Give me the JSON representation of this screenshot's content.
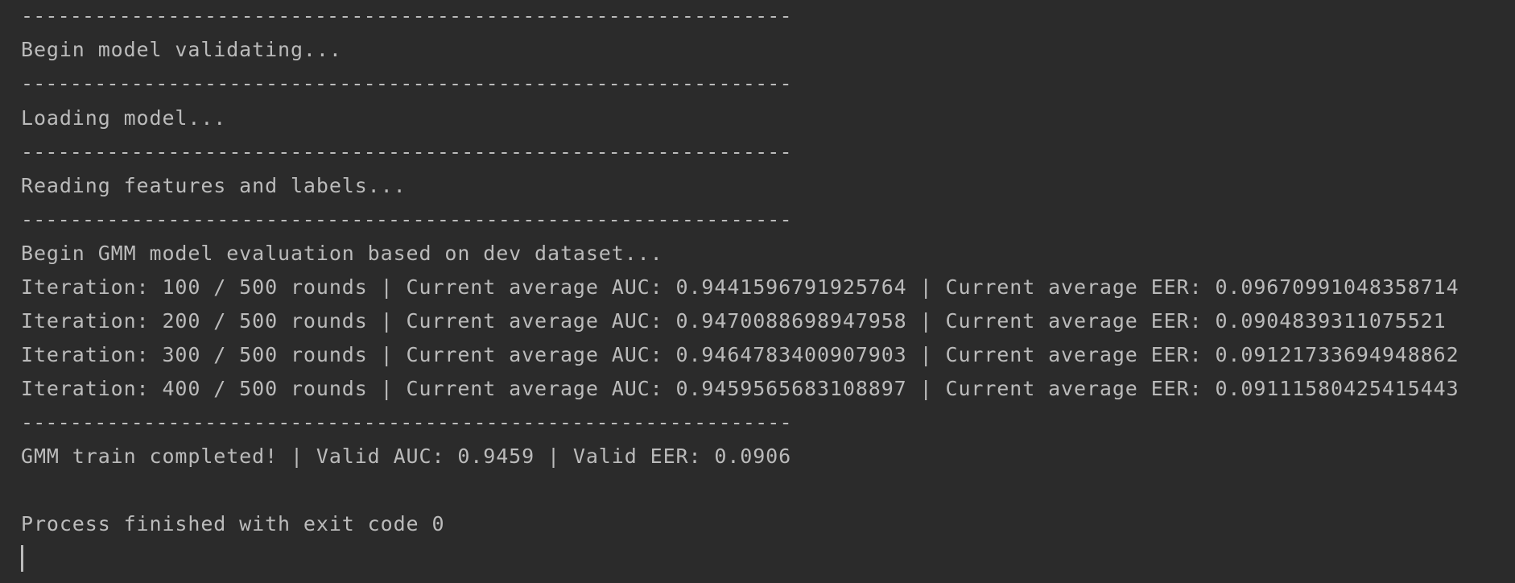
{
  "console": {
    "separator": "---------------------------------------------------------------",
    "lines": {
      "validating": "Begin model validating...",
      "loading": "Loading model...",
      "reading": "Reading features and labels...",
      "gmm_eval": "Begin GMM model evaluation based on dev dataset...",
      "iter100": "Iteration: 100 / 500 rounds | Current average AUC: 0.9441596791925764 | Current average EER: 0.09670991048358714",
      "iter200": "Iteration: 200 / 500 rounds | Current average AUC: 0.9470088698947958 | Current average EER: 0.0904839311075521",
      "iter300": "Iteration: 300 / 500 rounds | Current average AUC: 0.9464783400907903 | Current average EER: 0.09121733694948862",
      "iter400": "Iteration: 400 / 500 rounds | Current average AUC: 0.9459565683108897 | Current average EER: 0.09111580425415443",
      "completed": "GMM train completed! | Valid AUC: 0.9459 | Valid EER: 0.0906",
      "exit": "Process finished with exit code 0"
    }
  }
}
